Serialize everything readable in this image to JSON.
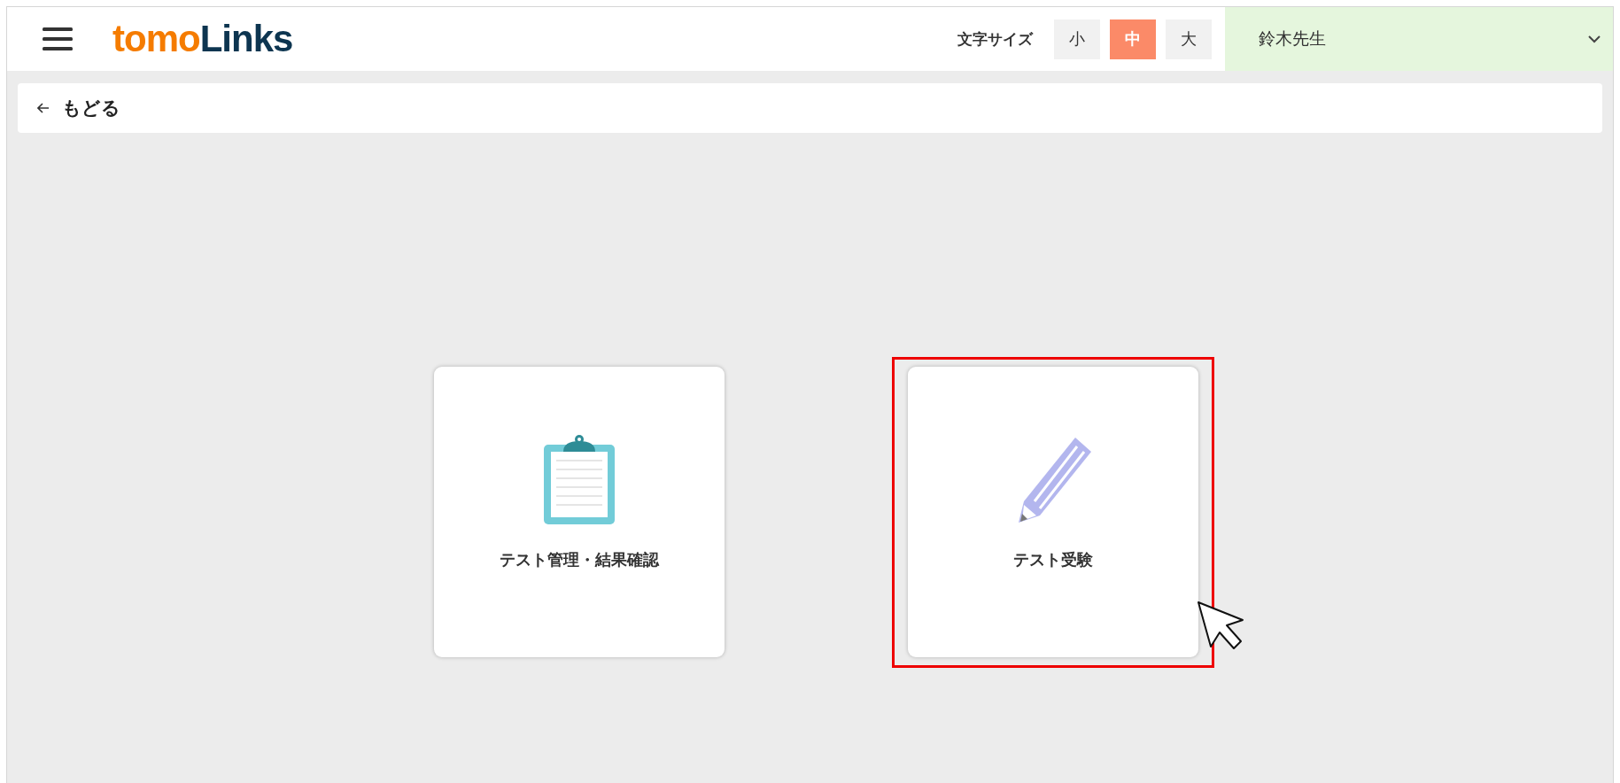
{
  "header": {
    "logo": [
      {
        "text": "tomo",
        "color": "#f57c00"
      },
      {
        "text": "Links",
        "color": "#0d3550"
      }
    ],
    "font_size": {
      "label": "文字サイズ",
      "options": [
        {
          "label": "小",
          "selected": false
        },
        {
          "label": "中",
          "selected": true
        },
        {
          "label": "大",
          "selected": false
        }
      ]
    },
    "user": {
      "name": "鈴木先生"
    }
  },
  "back": {
    "label": "もどる"
  },
  "cards": [
    {
      "kind": "clipboard",
      "label": "テスト管理・結果確認",
      "highlighted": false
    },
    {
      "kind": "pencil",
      "label": "テスト受験",
      "highlighted": true
    }
  ]
}
